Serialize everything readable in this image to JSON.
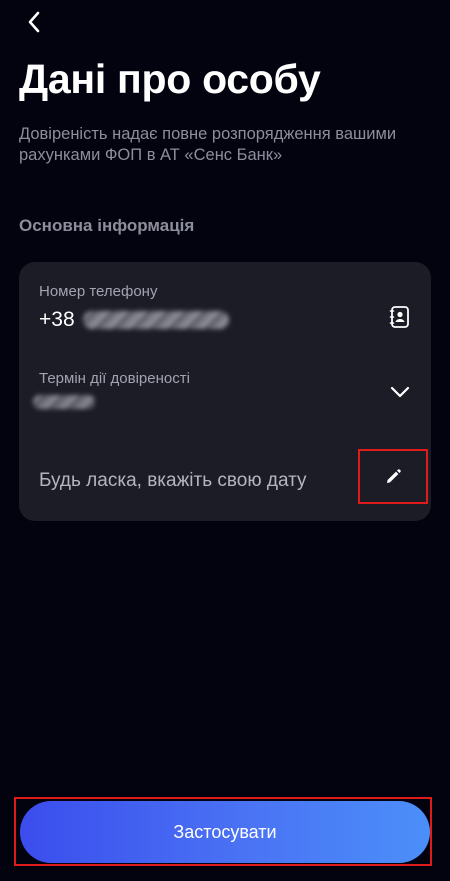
{
  "header": {
    "back_icon": "chevron-left-icon",
    "title": "Дані про особу",
    "subtitle": "Довіреність надає повне розпорядження вашими рахунками ФОП в АТ «Сенс Банк»"
  },
  "section": {
    "title": "Основна інформація"
  },
  "form": {
    "phone": {
      "label": "Номер телефону",
      "prefix": "+38",
      "icon": "contacts-book-icon"
    },
    "term": {
      "label": "Термін дії довіреності",
      "icon": "chevron-down-icon"
    },
    "date": {
      "placeholder": "Будь ласка, вкажіть свою дату",
      "icon": "pencil-icon"
    }
  },
  "footer": {
    "apply_label": "Застосувати"
  },
  "colors": {
    "background": "#03030f",
    "card": "#1c1c27",
    "accent_start": "#3b4ded",
    "accent_end": "#4b8ff9",
    "highlight": "#e01b1b"
  }
}
